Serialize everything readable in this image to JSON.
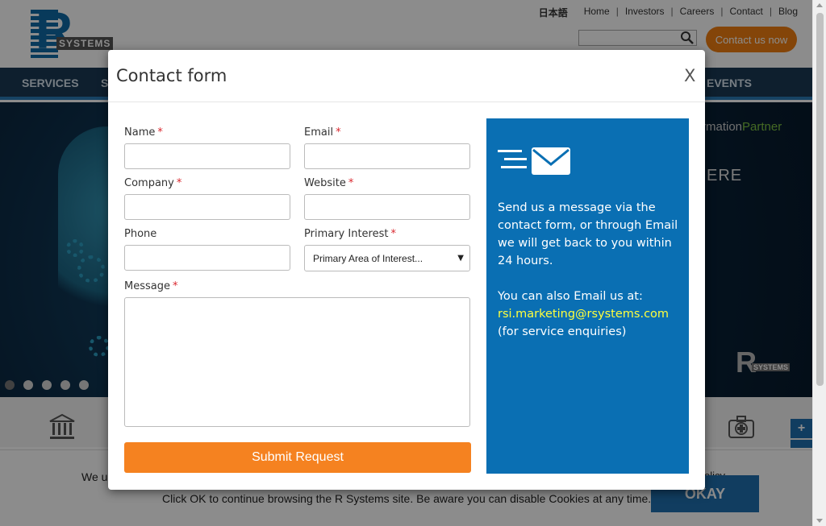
{
  "site": {
    "logo": {
      "letter": "R",
      "word": "SYSTEMS"
    },
    "top_links": [
      "日本語",
      "Home",
      "Investors",
      "Careers",
      "Contact",
      "Blog"
    ],
    "separator": "|",
    "cta_label": "Contact us now",
    "nav": [
      "SERVICES",
      "S",
      "EVENTS"
    ],
    "hero": {
      "tag_prefix": "rmation",
      "tag_highlight": "Partner",
      "partial_heading": "ERE",
      "logo_letter": "R",
      "logo_word": "SYSTEMS"
    },
    "zoom_plus": "+",
    "cookie": {
      "line1": "We u",
      "line1_tail": "olicy",
      "line2": "Click OK to continue browsing the R Systems site. Be aware you can disable Cookies at any time.",
      "okay_label": "OKAY"
    }
  },
  "modal": {
    "title": "Contact form",
    "close_label": "X",
    "required_mark": "*",
    "fields": {
      "name": {
        "label": "Name",
        "value": ""
      },
      "email": {
        "label": "Email",
        "value": ""
      },
      "company": {
        "label": "Company",
        "value": ""
      },
      "website": {
        "label": "Website",
        "value": ""
      },
      "phone": {
        "label": "Phone",
        "value": ""
      },
      "interest": {
        "label": "Primary Interest",
        "selected": "Primary Area of Interest...",
        "arrow": "▼"
      },
      "message": {
        "label": "Message",
        "value": ""
      }
    },
    "submit_label": "Submit Request",
    "info": {
      "text1": "Send us a message via the contact form, or through Email we will get back to you within 24 hours.",
      "text2": "You can also Email us at:",
      "email": "rsi.marketing@rsystems.com",
      "text3": "(for service enquiries)"
    }
  },
  "colors": {
    "accent_orange": "#f58220",
    "panel_blue": "#0a6fb3",
    "nav_navy": "#1a3a55",
    "email_yellow": "#ffff3d",
    "required_red": "#d9272e"
  }
}
